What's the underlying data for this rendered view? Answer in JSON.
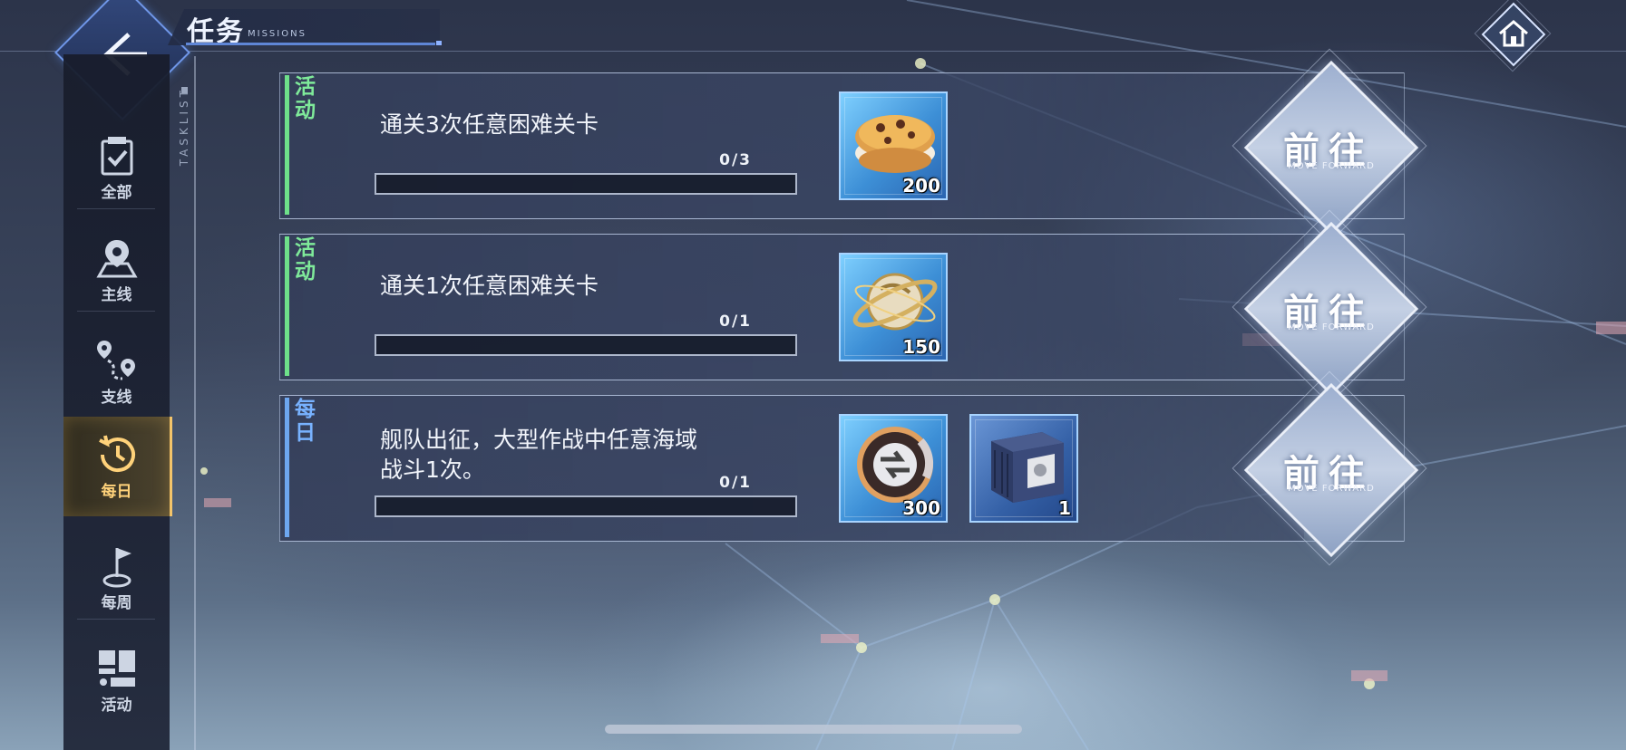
{
  "header": {
    "title": "任务",
    "subtitle": "MISSIONS",
    "back_icon": "arrow-left-icon",
    "home_icon": "home-icon"
  },
  "sidebar": {
    "tasklist_label": "TASKLIST",
    "items": [
      {
        "label": "全部",
        "icon": "clipboard-check-icon",
        "active": false
      },
      {
        "label": "主线",
        "icon": "map-pin-icon",
        "active": false
      },
      {
        "label": "支线",
        "icon": "route-pins-icon",
        "active": false
      },
      {
        "label": "每日",
        "icon": "history-clock-icon",
        "active": true
      },
      {
        "label": "每周",
        "icon": "flag-icon",
        "active": false
      },
      {
        "label": "活动",
        "icon": "blocks-icon",
        "active": false
      }
    ]
  },
  "tasks": [
    {
      "tag": "活动",
      "tag_color": "#7fea9a",
      "description": "通关3次任意困难关卡",
      "progress_text": "0/3",
      "progress_fraction": 0,
      "rewards": [
        {
          "item": "cookie-icon",
          "qty": "200"
        }
      ],
      "button": {
        "label": "前往",
        "sub": "MOVE FORWARD"
      }
    },
    {
      "tag": "活动",
      "tag_color": "#7fea9a",
      "description": "通关1次任意困难关卡",
      "progress_text": "0/1",
      "progress_fraction": 0,
      "rewards": [
        {
          "item": "gold-orb-icon",
          "qty": "150"
        }
      ],
      "button": {
        "label": "前往",
        "sub": "MOVE FORWARD"
      }
    },
    {
      "tag": "每日",
      "tag_color": "#78b2ff",
      "description_line1": "舰队出征，大型作战中任意海域",
      "description_line2": "战斗1次。",
      "progress_text": "0/1",
      "progress_fraction": 0,
      "rewards": [
        {
          "item": "exchange-token-icon",
          "qty": "300"
        },
        {
          "item": "supply-crate-icon",
          "qty": "1"
        }
      ],
      "button": {
        "label": "前往",
        "sub": "MOVE FORWARD"
      }
    }
  ],
  "colors": {
    "accent_blue": "#6f96e8",
    "active_gold": "#ffd27a",
    "event_green": "#7fea9a",
    "daily_blue": "#78b2ff"
  }
}
